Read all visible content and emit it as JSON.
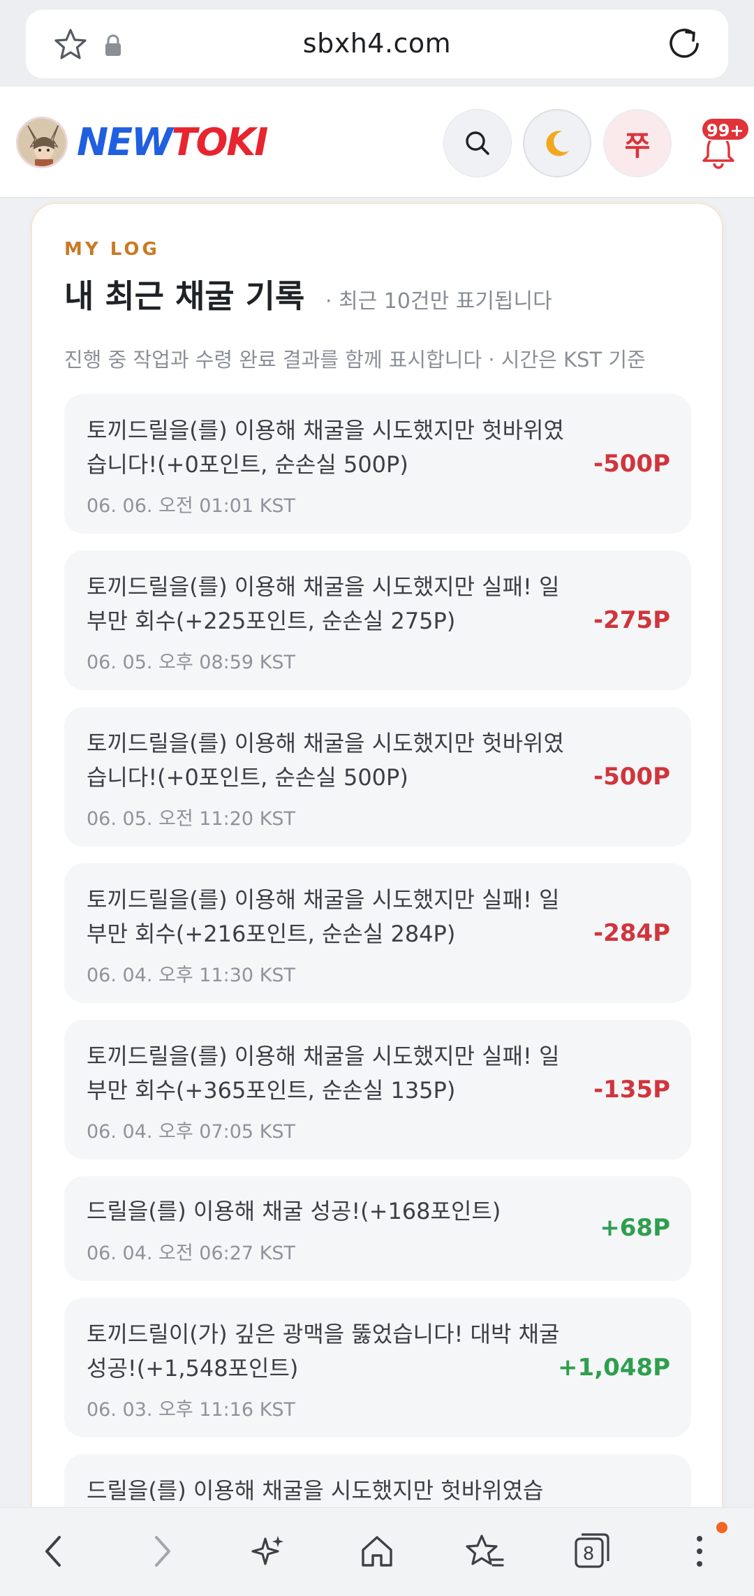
{
  "browser": {
    "url": "sbxh4.com",
    "tab_count": "8"
  },
  "header": {
    "logo_part1": "NEW",
    "logo_part2": "TOKI",
    "user_initial": "쭈",
    "notification_badge": "99+"
  },
  "section": {
    "eyebrow": "MY LOG",
    "title": "내 최근 채굴 기록",
    "title_note": "· 최근 10건만 표기됩니다",
    "subtitle": "진행 중 작업과 수령 완료 결과를 함께 표시합니다 · 시간은 KST 기준"
  },
  "logs": [
    {
      "message": "토끼드릴을(를) 이용해 채굴을 시도했지만 헛바위였습니다!(+0포인트, 순손실 500P)",
      "time": "06. 06. 오전 01:01 KST",
      "amount": "-500P",
      "sign": "negative"
    },
    {
      "message": "토끼드릴을(를) 이용해 채굴을 시도했지만 실패! 일부만 회수(+225포인트, 순손실 275P)",
      "time": "06. 05. 오후 08:59 KST",
      "amount": "-275P",
      "sign": "negative"
    },
    {
      "message": "토끼드릴을(를) 이용해 채굴을 시도했지만 헛바위였습니다!(+0포인트, 순손실 500P)",
      "time": "06. 05. 오전 11:20 KST",
      "amount": "-500P",
      "sign": "negative"
    },
    {
      "message": "토끼드릴을(를) 이용해 채굴을 시도했지만 실패! 일부만 회수(+216포인트, 순손실 284P)",
      "time": "06. 04. 오후 11:30 KST",
      "amount": "-284P",
      "sign": "negative"
    },
    {
      "message": "토끼드릴을(를) 이용해 채굴을 시도했지만 실패! 일부만 회수(+365포인트, 순손실 135P)",
      "time": "06. 04. 오후 07:05 KST",
      "amount": "-135P",
      "sign": "negative"
    },
    {
      "message": "드릴을(를) 이용해 채굴 성공!(+168포인트)",
      "time": "06. 04. 오전 06:27 KST",
      "amount": "+68P",
      "sign": "positive"
    },
    {
      "message": "토끼드릴이(가) 깊은 광맥을 뚫었습니다! 대박 채굴 성공!(+1,548포인트)",
      "time": "06. 03. 오후 11:16 KST",
      "amount": "+1,048P",
      "sign": "positive"
    },
    {
      "message": "드릴을(를) 이용해 채굴을 시도했지만 헛바위였습",
      "time": "",
      "amount": "",
      "sign": "negative"
    }
  ],
  "colors": {
    "negative": "#d0353c",
    "positive": "#2f9e4f",
    "eyebrow": "#c87a25",
    "logo_blue": "#1f5fe0",
    "logo_red": "#e8242f"
  },
  "icons": {
    "url_bar": [
      "star-icon",
      "lock-icon",
      "reload-icon"
    ],
    "header": [
      "search-icon",
      "moon-icon",
      "bell-icon"
    ],
    "bottom_nav": [
      "back-icon",
      "forward-icon",
      "sparkle-icon",
      "home-icon",
      "bookmarks-icon",
      "tabs-icon",
      "more-icon"
    ]
  }
}
